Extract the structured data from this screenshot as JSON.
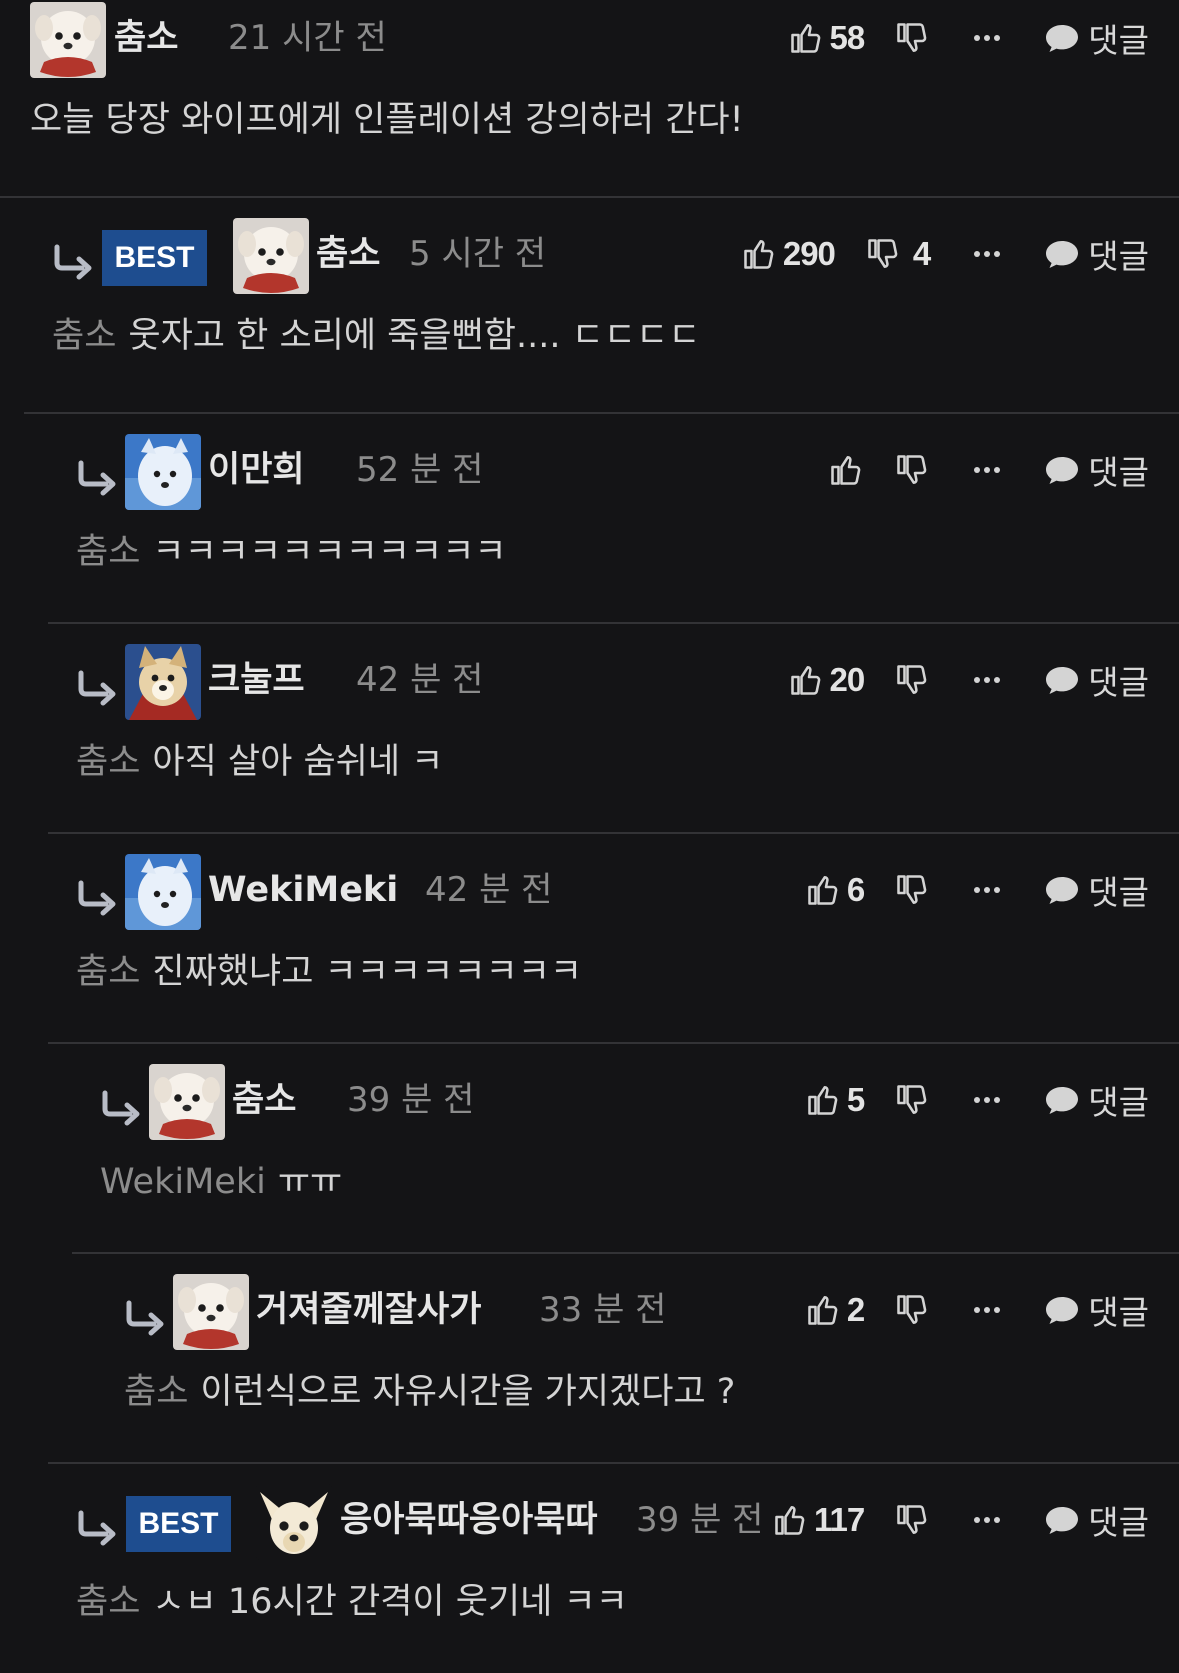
{
  "labels": {
    "best": "BEST",
    "reply": "댓글"
  },
  "icons": {
    "like": "thumbs-up-icon",
    "dislike": "thumbs-down-icon",
    "more": "more-dots-icon",
    "reply": "speech-bubble-icon",
    "reply_arrow": "reply-arrow-icon"
  },
  "colors": {
    "background": "#141416",
    "best_badge": "#1e4d8f",
    "separator": "#333336",
    "muted_text": "#8c8c8c"
  },
  "comments": [
    {
      "author": "춤소",
      "time": "21 시간 전",
      "likes": "58",
      "dislikes": "",
      "mention": "",
      "text": "오늘 당장 와이프에게 인플레이션 강의하러 간다!",
      "best": false,
      "avatar": "white-dog"
    },
    {
      "author": "춤소",
      "time": "5 시간 전",
      "likes": "290",
      "dislikes": "4",
      "mention": "춤소",
      "text": "웃자고 한 소리에 죽을뻔함.... ㄷㄷㄷㄷ",
      "best": true,
      "avatar": "white-dog"
    },
    {
      "author": "이만희",
      "time": "52 분 전",
      "likes": "",
      "dislikes": "",
      "mention": "춤소",
      "text": "ㅋㅋㅋㅋㅋㅋㅋㅋㅋㅋㅋ",
      "best": false,
      "avatar": "blue-dog"
    },
    {
      "author": "크눌프",
      "time": "42 분 전",
      "likes": "20",
      "dislikes": "",
      "mention": "춤소",
      "text": "아직 살아 숨쉬네 ㅋ",
      "best": false,
      "avatar": "fox-dog"
    },
    {
      "author": "WekiMeki",
      "time": "42 분 전",
      "likes": "6",
      "dislikes": "",
      "mention": "춤소",
      "text": "진짜했냐고 ㅋㅋㅋㅋㅋㅋㅋㅋ",
      "best": false,
      "avatar": "blue-dog"
    },
    {
      "author": "춤소",
      "time": "39 분 전",
      "likes": "5",
      "dislikes": "",
      "mention": "WekiMeki",
      "text": "ㅠㅠ",
      "best": false,
      "avatar": "white-dog"
    },
    {
      "author": "거져줄께잘사가",
      "time": "33 분 전",
      "likes": "2",
      "dislikes": "",
      "mention": "춤소",
      "text": "이런식으로 자유시간을 가지겠다고 ?",
      "best": false,
      "avatar": "white-dog"
    },
    {
      "author": "응아묵따응아묵따",
      "time": "39 분 전",
      "likes": "117",
      "dislikes": "",
      "mention": "춤소",
      "text": "ㅅㅂ 16시간 간격이 웃기네 ㅋㅋ",
      "best": true,
      "avatar": "chihuahua"
    }
  ]
}
